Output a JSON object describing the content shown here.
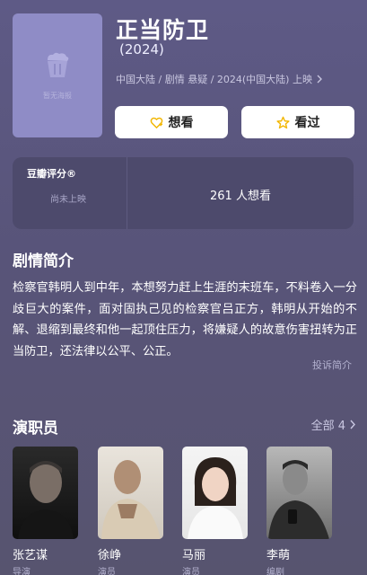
{
  "movie": {
    "title": "正当防卫",
    "year": "(2024)",
    "meta": "中国大陆 / 剧情 悬疑 / 2024(中国大陆) 上映",
    "poster_placeholder": "暂无海报"
  },
  "actions": {
    "want_label": "想看",
    "seen_label": "看过"
  },
  "rating": {
    "label": "豆瓣评分®",
    "status": "尚未上映",
    "wish_count": "261 人想看"
  },
  "synopsis": {
    "heading": "剧情简介",
    "text": "检察官韩明人到中年，本想努力赶上生涯的末班车，不料卷入一分歧巨大的案件，面对固执己见的检察官吕正方，韩明从开始的不解、退缩到最终和他一起顶住压力，将嫌疑人的故意伤害扭转为正当防卫，还法律以公平、公正。",
    "collapse": "投诉简介"
  },
  "cast": {
    "heading": "演职员",
    "all_label": "全部 4",
    "members": [
      {
        "name": "张艺谋",
        "role": "导演"
      },
      {
        "name": "徐峥",
        "role": "演员"
      },
      {
        "name": "马丽",
        "role": "演员"
      },
      {
        "name": "李萌",
        "role": "编剧"
      }
    ]
  },
  "colors": {
    "background": "#5a5680",
    "poster_placeholder": "#8f8cc6",
    "card": "#4d4a6c",
    "button_bg": "#ffffff",
    "icon_yellow": "#f2b705"
  },
  "icons": {
    "want": "heart-plus-icon",
    "seen": "star-icon",
    "meta_more": "chevron-right-icon",
    "cast_more": "chevron-right-icon",
    "poster": "popcorn-icon"
  }
}
